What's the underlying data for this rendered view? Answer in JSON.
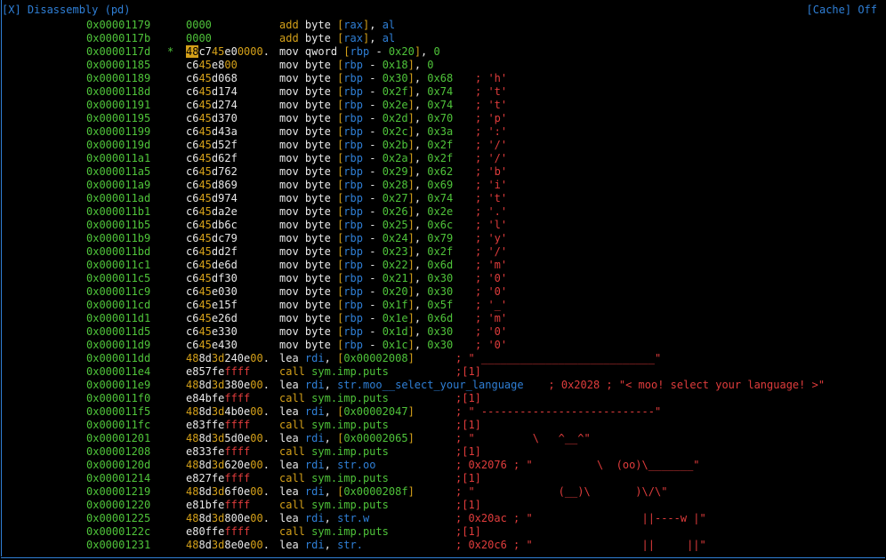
{
  "window": {
    "title": "[X] Disassembly (pd)",
    "cache_label": "[Cache] Off"
  },
  "colors": {
    "background": "#000000",
    "address": "#4fc43a",
    "frame": "#2f7fd6",
    "bytes_orange": "#d4a019",
    "bytes_red": "#e03c3c",
    "comment": "#e03c3c",
    "register": "#2f7fd6"
  },
  "rows": [
    {
      "addr": "0x00001179",
      "marker": "",
      "bytes": [
        [
          "0000",
          "g"
        ]
      ],
      "instr": "add byte [rax], al",
      "comment": ""
    },
    {
      "addr": "0x0000117b",
      "marker": "",
      "bytes": [
        [
          "0000",
          "g"
        ]
      ],
      "instr": "add byte [rax], al",
      "comment": ""
    },
    {
      "addr": "0x0000117d",
      "marker": "*",
      "bytes": [
        [
          "48",
          "cur"
        ],
        [
          "c7",
          "n"
        ],
        [
          "45",
          "o"
        ],
        [
          "e0",
          "n"
        ],
        [
          "0000",
          "o"
        ],
        [
          ".",
          "n"
        ]
      ],
      "instr": "mov qword [rbp - 0x20], 0",
      "comment": ""
    },
    {
      "addr": "0x00001185",
      "marker": "",
      "bytes": [
        [
          "c6",
          "n"
        ],
        [
          "45",
          "o"
        ],
        [
          "e8",
          "n"
        ],
        [
          "00",
          "o"
        ]
      ],
      "instr": "mov byte [rbp - 0x18], 0",
      "comment": ""
    },
    {
      "addr": "0x00001189",
      "marker": "",
      "bytes": [
        [
          "c6",
          "n"
        ],
        [
          "45",
          "o"
        ],
        [
          "d068",
          "n"
        ]
      ],
      "instr": "mov byte [rbp - 0x30], 0x68",
      "comment": "; 'h'"
    },
    {
      "addr": "0x0000118d",
      "marker": "",
      "bytes": [
        [
          "c6",
          "n"
        ],
        [
          "45",
          "o"
        ],
        [
          "d174",
          "n"
        ]
      ],
      "instr": "mov byte [rbp - 0x2f], 0x74",
      "comment": "; 't'"
    },
    {
      "addr": "0x00001191",
      "marker": "",
      "bytes": [
        [
          "c6",
          "n"
        ],
        [
          "45",
          "o"
        ],
        [
          "d274",
          "n"
        ]
      ],
      "instr": "mov byte [rbp - 0x2e], 0x74",
      "comment": "; 't'"
    },
    {
      "addr": "0x00001195",
      "marker": "",
      "bytes": [
        [
          "c6",
          "n"
        ],
        [
          "45",
          "o"
        ],
        [
          "d370",
          "n"
        ]
      ],
      "instr": "mov byte [rbp - 0x2d], 0x70",
      "comment": "; 'p'"
    },
    {
      "addr": "0x00001199",
      "marker": "",
      "bytes": [
        [
          "c6",
          "n"
        ],
        [
          "45",
          "o"
        ],
        [
          "d43a",
          "n"
        ]
      ],
      "instr": "mov byte [rbp - 0x2c], 0x3a",
      "comment": "; ':'"
    },
    {
      "addr": "0x0000119d",
      "marker": "",
      "bytes": [
        [
          "c6",
          "n"
        ],
        [
          "45",
          "o"
        ],
        [
          "d52f",
          "n"
        ]
      ],
      "instr": "mov byte [rbp - 0x2b], 0x2f",
      "comment": "; '/'"
    },
    {
      "addr": "0x000011a1",
      "marker": "",
      "bytes": [
        [
          "c6",
          "n"
        ],
        [
          "45",
          "o"
        ],
        [
          "d62f",
          "n"
        ]
      ],
      "instr": "mov byte [rbp - 0x2a], 0x2f",
      "comment": "; '/'"
    },
    {
      "addr": "0x000011a5",
      "marker": "",
      "bytes": [
        [
          "c6",
          "n"
        ],
        [
          "45",
          "o"
        ],
        [
          "d762",
          "n"
        ]
      ],
      "instr": "mov byte [rbp - 0x29], 0x62",
      "comment": "; 'b'"
    },
    {
      "addr": "0x000011a9",
      "marker": "",
      "bytes": [
        [
          "c6",
          "n"
        ],
        [
          "45",
          "o"
        ],
        [
          "d869",
          "n"
        ]
      ],
      "instr": "mov byte [rbp - 0x28], 0x69",
      "comment": "; 'i'"
    },
    {
      "addr": "0x000011ad",
      "marker": "",
      "bytes": [
        [
          "c6",
          "n"
        ],
        [
          "45",
          "o"
        ],
        [
          "d974",
          "n"
        ]
      ],
      "instr": "mov byte [rbp - 0x27], 0x74",
      "comment": "; 't'"
    },
    {
      "addr": "0x000011b1",
      "marker": "",
      "bytes": [
        [
          "c6",
          "n"
        ],
        [
          "45",
          "o"
        ],
        [
          "da2e",
          "n"
        ]
      ],
      "instr": "mov byte [rbp - 0x26], 0x2e",
      "comment": "; '.'"
    },
    {
      "addr": "0x000011b5",
      "marker": "",
      "bytes": [
        [
          "c6",
          "n"
        ],
        [
          "45",
          "o"
        ],
        [
          "db6c",
          "n"
        ]
      ],
      "instr": "mov byte [rbp - 0x25], 0x6c",
      "comment": "; 'l'"
    },
    {
      "addr": "0x000011b9",
      "marker": "",
      "bytes": [
        [
          "c6",
          "n"
        ],
        [
          "45",
          "o"
        ],
        [
          "dc79",
          "n"
        ]
      ],
      "instr": "mov byte [rbp - 0x24], 0x79",
      "comment": "; 'y'"
    },
    {
      "addr": "0x000011bd",
      "marker": "",
      "bytes": [
        [
          "c6",
          "n"
        ],
        [
          "45",
          "o"
        ],
        [
          "dd2f",
          "n"
        ]
      ],
      "instr": "mov byte [rbp - 0x23], 0x2f",
      "comment": "; '/'"
    },
    {
      "addr": "0x000011c1",
      "marker": "",
      "bytes": [
        [
          "c6",
          "n"
        ],
        [
          "45",
          "o"
        ],
        [
          "de6d",
          "n"
        ]
      ],
      "instr": "mov byte [rbp - 0x22], 0x6d",
      "comment": "; 'm'"
    },
    {
      "addr": "0x000011c5",
      "marker": "",
      "bytes": [
        [
          "c6",
          "n"
        ],
        [
          "45",
          "o"
        ],
        [
          "df30",
          "n"
        ]
      ],
      "instr": "mov byte [rbp - 0x21], 0x30",
      "comment": "; '0'"
    },
    {
      "addr": "0x000011c9",
      "marker": "",
      "bytes": [
        [
          "c6",
          "n"
        ],
        [
          "45",
          "o"
        ],
        [
          "e030",
          "n"
        ]
      ],
      "instr": "mov byte [rbp - 0x20], 0x30",
      "comment": "; '0'"
    },
    {
      "addr": "0x000011cd",
      "marker": "",
      "bytes": [
        [
          "c6",
          "n"
        ],
        [
          "45",
          "o"
        ],
        [
          "e15f",
          "n"
        ]
      ],
      "instr": "mov byte [rbp - 0x1f], 0x5f",
      "comment": "; '_'"
    },
    {
      "addr": "0x000011d1",
      "marker": "",
      "bytes": [
        [
          "c6",
          "n"
        ],
        [
          "45",
          "o"
        ],
        [
          "e26d",
          "n"
        ]
      ],
      "instr": "mov byte [rbp - 0x1e], 0x6d",
      "comment": "; 'm'"
    },
    {
      "addr": "0x000011d5",
      "marker": "",
      "bytes": [
        [
          "c6",
          "n"
        ],
        [
          "45",
          "o"
        ],
        [
          "e330",
          "n"
        ]
      ],
      "instr": "mov byte [rbp - 0x1d], 0x30",
      "comment": "; '0'"
    },
    {
      "addr": "0x000011d9",
      "marker": "",
      "bytes": [
        [
          "c6",
          "n"
        ],
        [
          "45",
          "o"
        ],
        [
          "e430",
          "n"
        ]
      ],
      "instr": "mov byte [rbp - 0x1c], 0x30",
      "comment": "; '0'"
    },
    {
      "addr": "0x000011dd",
      "marker": "",
      "bytes": [
        [
          "48",
          "o"
        ],
        [
          "8d",
          "n"
        ],
        [
          "3d",
          "o"
        ],
        [
          "240e",
          "n"
        ],
        [
          "00",
          "o"
        ],
        [
          ".",
          "n"
        ]
      ],
      "instr": "lea rdi, [0x00002008]",
      "comment": "; \" ___________________________\""
    },
    {
      "addr": "0x000011e4",
      "marker": "",
      "bytes": [
        [
          "e857fe",
          "n"
        ],
        [
          "ffff",
          "r"
        ]
      ],
      "instr": "call sym.imp.puts",
      "comment": ";[1]"
    },
    {
      "addr": "0x000011e9",
      "marker": "",
      "bytes": [
        [
          "48",
          "o"
        ],
        [
          "8d",
          "n"
        ],
        [
          "3d",
          "o"
        ],
        [
          "380e",
          "n"
        ],
        [
          "00",
          "o"
        ],
        [
          ".",
          "n"
        ]
      ],
      "instr": "lea rdi, str.moo__select_your_language",
      "comment": "; 0x2028 ; \"< moo! select your language! >\""
    },
    {
      "addr": "0x000011f0",
      "marker": "",
      "bytes": [
        [
          "e84bfe",
          "n"
        ],
        [
          "ffff",
          "r"
        ]
      ],
      "instr": "call sym.imp.puts",
      "comment": ";[1]"
    },
    {
      "addr": "0x000011f5",
      "marker": "",
      "bytes": [
        [
          "48",
          "o"
        ],
        [
          "8d",
          "n"
        ],
        [
          "3d",
          "o"
        ],
        [
          "4b0e",
          "n"
        ],
        [
          "00",
          "o"
        ],
        [
          ".",
          "n"
        ]
      ],
      "instr": "lea rdi, [0x00002047]",
      "comment": "; \" ---------------------------\""
    },
    {
      "addr": "0x000011fc",
      "marker": "",
      "bytes": [
        [
          "e83ffe",
          "n"
        ],
        [
          "ffff",
          "r"
        ]
      ],
      "instr": "call sym.imp.puts",
      "comment": ";[1]"
    },
    {
      "addr": "0x00001201",
      "marker": "",
      "bytes": [
        [
          "48",
          "o"
        ],
        [
          "8d",
          "n"
        ],
        [
          "3d",
          "o"
        ],
        [
          "5d0e",
          "n"
        ],
        [
          "00",
          "o"
        ],
        [
          ".",
          "n"
        ]
      ],
      "instr": "lea rdi, [0x00002065]",
      "comment": "; \"         \\   ^__^\""
    },
    {
      "addr": "0x00001208",
      "marker": "",
      "bytes": [
        [
          "e833fe",
          "n"
        ],
        [
          "ffff",
          "r"
        ]
      ],
      "instr": "call sym.imp.puts",
      "comment": ";[1]"
    },
    {
      "addr": "0x0000120d",
      "marker": "",
      "bytes": [
        [
          "48",
          "o"
        ],
        [
          "8d",
          "n"
        ],
        [
          "3d",
          "o"
        ],
        [
          "620e",
          "n"
        ],
        [
          "00",
          "o"
        ],
        [
          ".",
          "n"
        ]
      ],
      "instr": "lea rdi, str.oo",
      "comment": "; 0x2076 ; \"          \\  (oo)\\_______\""
    },
    {
      "addr": "0x00001214",
      "marker": "",
      "bytes": [
        [
          "e827fe",
          "n"
        ],
        [
          "ffff",
          "r"
        ]
      ],
      "instr": "call sym.imp.puts",
      "comment": ";[1]"
    },
    {
      "addr": "0x00001219",
      "marker": "",
      "bytes": [
        [
          "48",
          "o"
        ],
        [
          "8d",
          "n"
        ],
        [
          "3d",
          "o"
        ],
        [
          "6f0e",
          "n"
        ],
        [
          "00",
          "o"
        ],
        [
          ".",
          "n"
        ]
      ],
      "instr": "lea rdi, [0x0000208f]",
      "comment": "; \"             (__)\\       )\\/\\\""
    },
    {
      "addr": "0x00001220",
      "marker": "",
      "bytes": [
        [
          "e81bfe",
          "n"
        ],
        [
          "ffff",
          "r"
        ]
      ],
      "instr": "call sym.imp.puts",
      "comment": ";[1]"
    },
    {
      "addr": "0x00001225",
      "marker": "",
      "bytes": [
        [
          "48",
          "o"
        ],
        [
          "8d",
          "n"
        ],
        [
          "3d",
          "o"
        ],
        [
          "800e",
          "n"
        ],
        [
          "00",
          "o"
        ],
        [
          ".",
          "n"
        ]
      ],
      "instr": "lea rdi, str.w",
      "comment": "; 0x20ac ; \"                 ||----w |\""
    },
    {
      "addr": "0x0000122c",
      "marker": "",
      "bytes": [
        [
          "e80ffe",
          "n"
        ],
        [
          "ffff",
          "r"
        ]
      ],
      "instr": "call sym.imp.puts",
      "comment": ";[1]"
    },
    {
      "addr": "0x00001231",
      "marker": "",
      "bytes": [
        [
          "48",
          "o"
        ],
        [
          "8d",
          "n"
        ],
        [
          "3d",
          "o"
        ],
        [
          "8e0e",
          "n"
        ],
        [
          "00",
          "o"
        ],
        [
          ".",
          "n"
        ]
      ],
      "instr": "lea rdi, str.",
      "comment": "; 0x20c6 ; \"                 ||     ||\""
    }
  ]
}
